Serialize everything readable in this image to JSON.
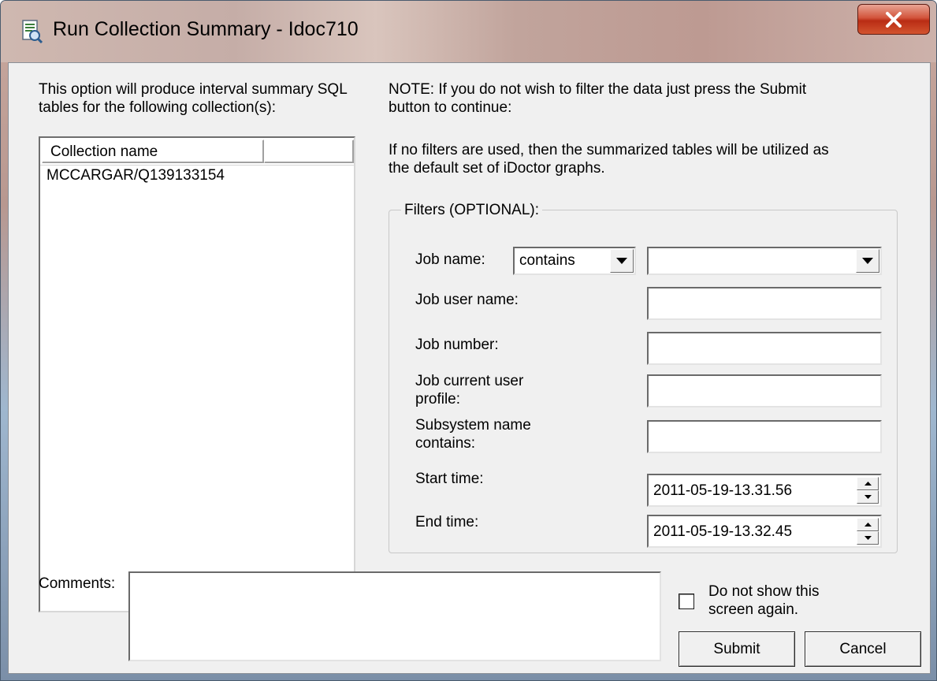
{
  "window": {
    "title": "Run Collection Summary - Idoc710",
    "close_label": "X"
  },
  "intro_text": [
    "This option will produce interval summary SQL",
    "tables for the following collection(s):"
  ],
  "collections": {
    "column_header": "Collection name",
    "rows": [
      "MCCARGAR/Q139133154"
    ]
  },
  "note_text": [
    "NOTE: If you do not wish to filter the data just press the Submit",
    "button to continue:"
  ],
  "info_text": [
    "If no filters are used, then the summarized tables will be utilized as",
    "the default set of iDoctor graphs."
  ],
  "filters": {
    "legend": "Filters (OPTIONAL):",
    "job_name_label": "Job name:",
    "job_name_operator": "contains",
    "job_name_value": "",
    "job_user_name_label": "Job user name:",
    "job_user_name_value": "",
    "job_number_label": "Job number:",
    "job_number_value": "",
    "job_current_user_profile_label": [
      "Job current user",
      "profile:"
    ],
    "job_current_user_profile_value": "",
    "subsystem_label": [
      "Subsystem name",
      "contains:"
    ],
    "subsystem_value": "",
    "start_time_label": "Start time:",
    "start_time_value": "2011-05-19-13.31.56",
    "end_time_label": "End time:",
    "end_time_value": "2011-05-19-13.32.45"
  },
  "comments": {
    "label": "Comments:",
    "value": ""
  },
  "do_not_show": {
    "label": [
      "Do not show this",
      "screen again."
    ],
    "checked": false
  },
  "buttons": {
    "submit": "Submit",
    "cancel": "Cancel"
  }
}
